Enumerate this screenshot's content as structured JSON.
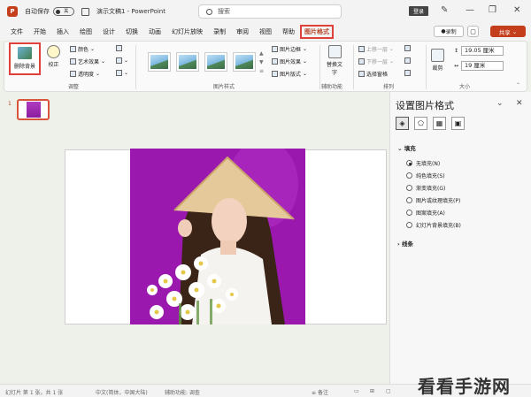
{
  "titlebar": {
    "app_logo": "P",
    "autosave_label": "自动保存",
    "autosave_state": "关",
    "doc_title": "演示文稿1 - PowerPoint",
    "search_placeholder": "搜索",
    "login_label": "登录"
  },
  "menu": {
    "tabs": [
      "文件",
      "开始",
      "插入",
      "绘图",
      "设计",
      "切换",
      "动画",
      "幻灯片放映",
      "录制",
      "审阅",
      "视图",
      "帮助",
      "图片格式"
    ],
    "active_tab": "图片格式",
    "record_label": "录制",
    "share_label": "共享"
  },
  "ribbon": {
    "remove_bg_label": "删除背景",
    "correct_label": "校正",
    "color_label": "颜色",
    "artistic_label": "艺术效果",
    "transparency_label": "透明度",
    "adjust_group": "调整",
    "styles_group": "图片样式",
    "border_label": "图片边框",
    "effects_label": "图片效果",
    "layout_label": "图片版式",
    "alt_text_label": "替换文字",
    "accessibility_group": "辅助功能",
    "bring_forward_label": "上移一层",
    "send_backward_label": "下移一层",
    "selection_pane_label": "选择窗格",
    "arrange_group": "排列",
    "crop_label": "裁剪",
    "height_value": "19.05 厘米",
    "width_value": "19 厘米",
    "size_group": "大小"
  },
  "thumbnails": {
    "slide_number": "1"
  },
  "pane": {
    "title": "设置图片格式",
    "fill_section": "填充",
    "fill_options": [
      "无填充(N)",
      "纯色填充(S)",
      "渐变填充(G)",
      "图片或纹理填充(P)",
      "图案填充(A)",
      "幻灯片背景填充(B)"
    ],
    "selected_fill": "无填充(N)",
    "line_section": "线条"
  },
  "statusbar": {
    "slide_info": "幻灯片 第 1 张，共 1 张",
    "language": "中文(简体，中国大陆)",
    "accessibility": "辅助功能: 调查",
    "notes_label": "备注"
  },
  "watermark": "看看手游网",
  "colors": {
    "accent": "#c43e1c",
    "highlight": "#e0403a",
    "photo_bg": "#9a18ae"
  }
}
